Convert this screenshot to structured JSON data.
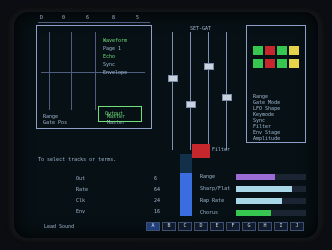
{
  "palette": {
    "screen_bg": "#071015",
    "frame": "#8d9fc6",
    "text": "#9fb8cf",
    "green": "#37c64f",
    "red": "#c5272d",
    "blue": "#3a6ee0",
    "yellow": "#e6d34a",
    "purple": "#9b6bd6",
    "cyan": "#a8d7e8"
  },
  "top_ruler": {
    "labels": [
      "D",
      "0",
      "6",
      "8",
      "5"
    ]
  },
  "left_panel": {
    "lines": [
      "Waveform",
      "Page 1",
      "Echo",
      "Sync",
      "Envelope"
    ],
    "readout_labels": [
      "Range",
      "Gate Pos"
    ],
    "readout_values": [
      "Master",
      "Master"
    ],
    "box_label": "Output"
  },
  "faders": {
    "header": "SET-GAT",
    "level_percent": [
      62,
      38,
      72,
      45
    ],
    "indicator": "Filter"
  },
  "right_panel": {
    "keyboard_colors": [
      "green",
      "red",
      "green",
      "yellow",
      "green",
      "red",
      "green",
      "yellow"
    ],
    "list": [
      "Range",
      "Gate Mode",
      "LFO Shape",
      "Keymode",
      "Sync",
      "Filter",
      "Env Stage",
      "Amplitude"
    ]
  },
  "status_line": "To select tracks or terms.",
  "param_rows": [
    {
      "label": "Out",
      "value": "6"
    },
    {
      "label": "Rate",
      "value": "64"
    },
    {
      "label": "Clk",
      "value": "24"
    },
    {
      "label": "Env",
      "value": "16"
    }
  ],
  "bottom_bars": {
    "labels": [
      "Range",
      "Sharp/Flat",
      "Rap Rate",
      "Chorus"
    ],
    "fill_fractions": [
      0.55,
      0.8,
      0.65,
      0.5
    ],
    "colors": [
      "purple",
      "cyan",
      "cyan",
      "green"
    ]
  },
  "bottom_bar": {
    "label": "Lead Sound",
    "tabs": [
      "A",
      "B",
      "C",
      "D",
      "E",
      "F",
      "G",
      "H",
      "I",
      "J"
    ]
  },
  "vertical_meter": {
    "level_fraction": 0.7
  }
}
